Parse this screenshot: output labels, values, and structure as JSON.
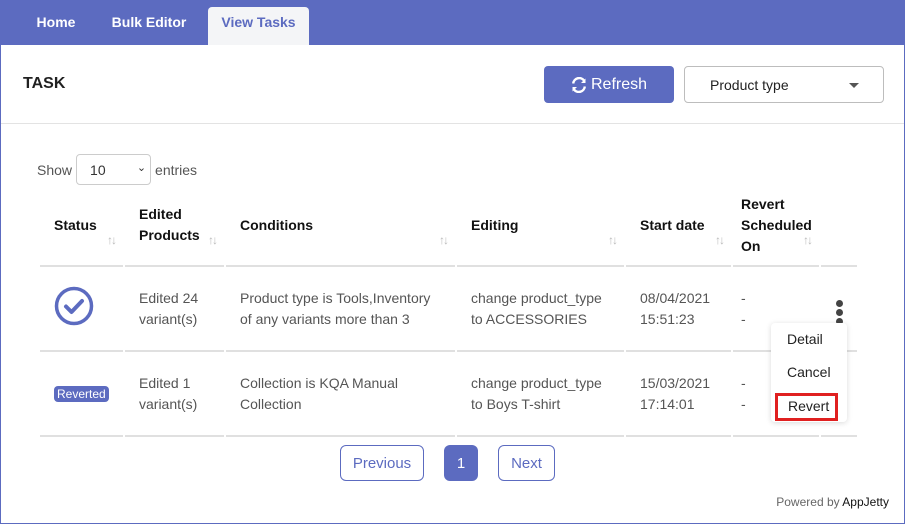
{
  "nav": {
    "tabs": [
      {
        "label": "Home",
        "active": false
      },
      {
        "label": "Bulk Editor",
        "active": false
      },
      {
        "label": "View Tasks",
        "active": true
      }
    ]
  },
  "header": {
    "title": "TASK",
    "refresh_label": "Refresh",
    "filter_select": "Product type"
  },
  "length_control": {
    "show_label": "Show",
    "value": "10",
    "entries_label": "entries"
  },
  "table": {
    "columns": [
      "Status",
      "Edited Products",
      "Conditions",
      "Editing",
      "Start date",
      "Revert Scheduled On"
    ],
    "rows": [
      {
        "status": "completed-check",
        "edited": "Edited 24 variant(s)",
        "conditions": "Product type is Tools,Inventory of any variants more than 3",
        "editing": "change product_type to ACCESSORIES",
        "start_date": "08/04/2021",
        "start_time": "15:51:23",
        "revert_1": "-",
        "revert_2": "-"
      },
      {
        "status": "Reverted",
        "edited": "Edited 1 variant(s)",
        "conditions": "Collection is KQA Manual Collection",
        "editing": "change product_type to Boys T-shirt",
        "start_date": "15/03/2021",
        "start_time": "17:14:01",
        "revert_1": "-",
        "revert_2": "-"
      }
    ]
  },
  "action_menu": {
    "items": [
      "Detail",
      "Cancel",
      "Revert"
    ],
    "highlighted": "Revert"
  },
  "pagination": {
    "previous": "Previous",
    "current": "1",
    "next": "Next"
  },
  "footer": {
    "powered_by": "Powered by",
    "brand": "AppJetty"
  },
  "colors": {
    "primary": "#5c6bc0",
    "highlight_border": "#e02020"
  }
}
